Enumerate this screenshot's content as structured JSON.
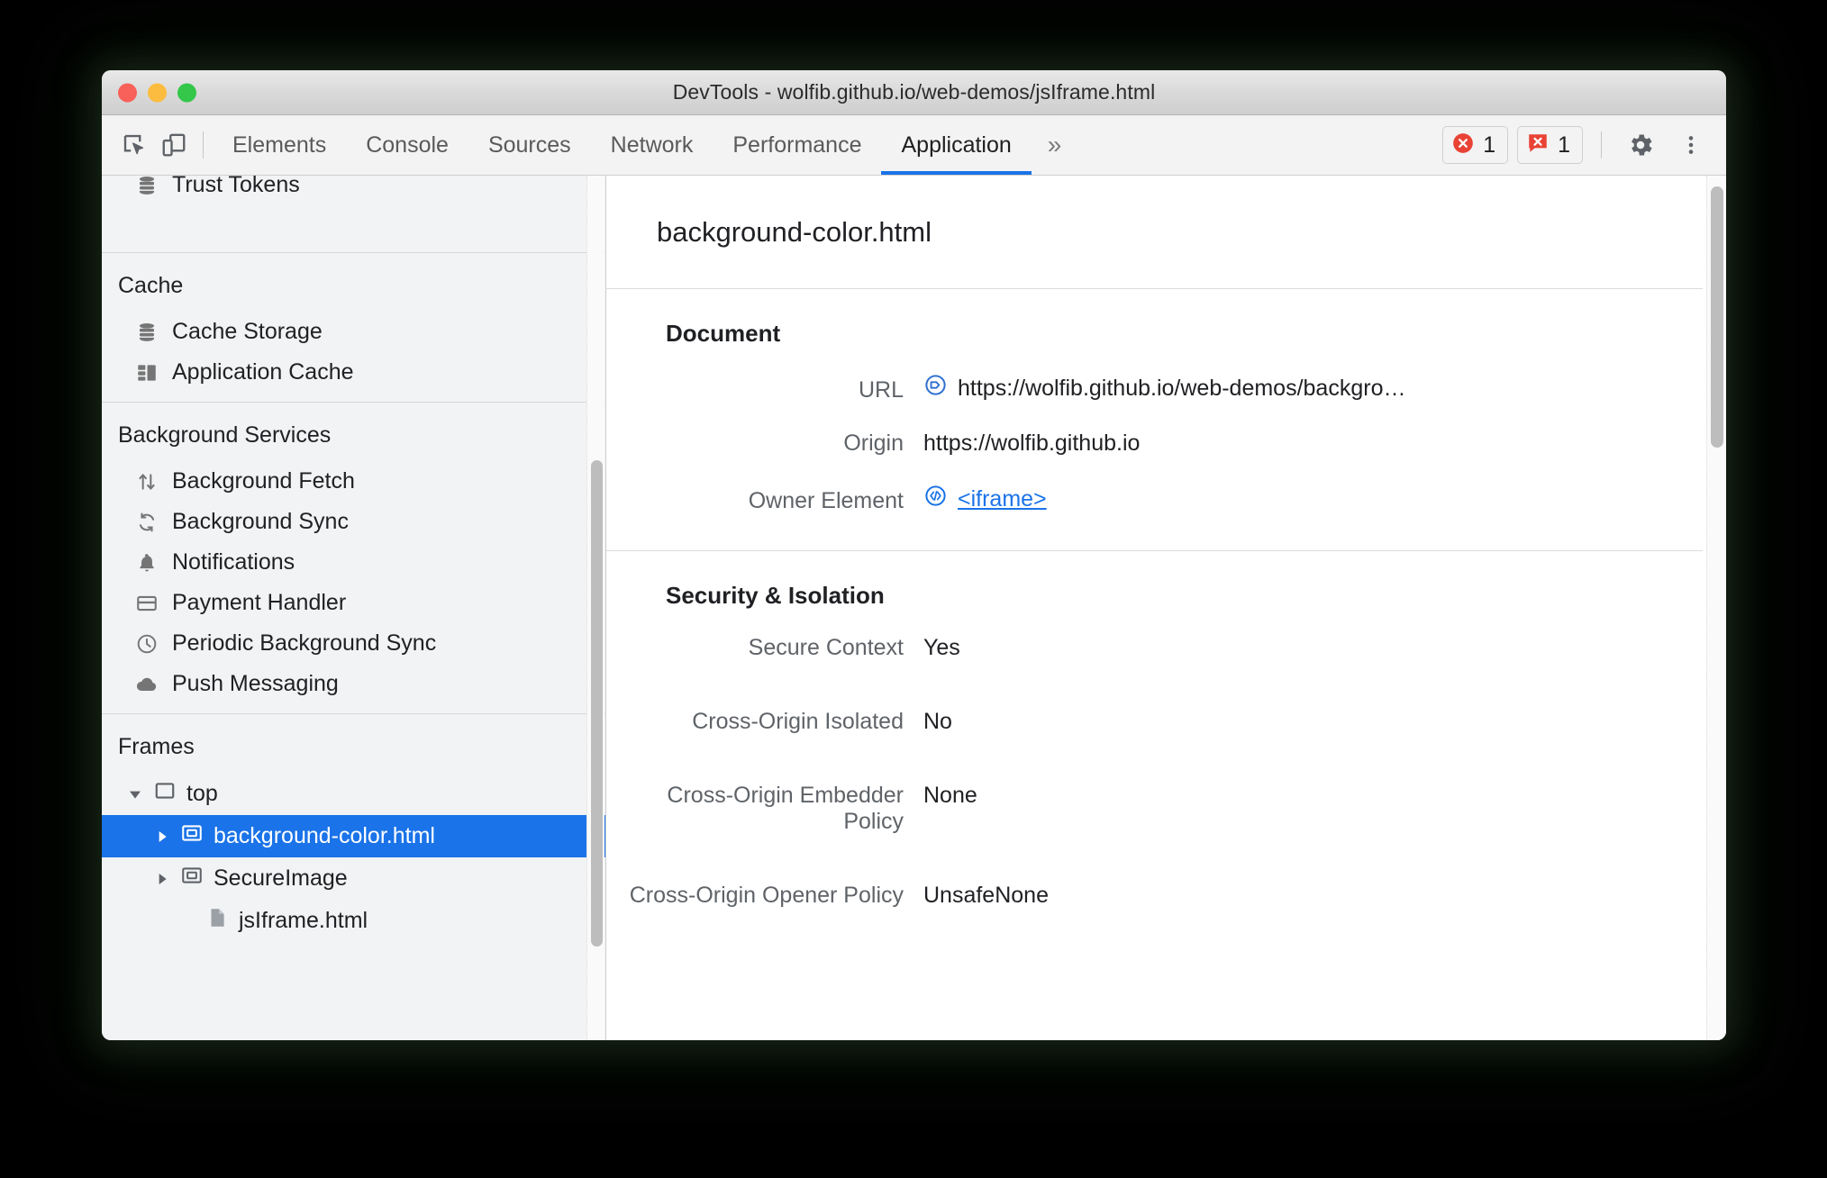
{
  "window": {
    "title": "DevTools - wolfib.github.io/web-demos/jsIframe.html",
    "traffic_lights": [
      "close-button",
      "minimize-button",
      "maximize-button"
    ]
  },
  "toolbar": {
    "inspect_icon": "inspect-element-icon",
    "device_icon": "device-toolbar-icon",
    "tabs": [
      {
        "label": "Elements",
        "active": false
      },
      {
        "label": "Console",
        "active": false
      },
      {
        "label": "Sources",
        "active": false
      },
      {
        "label": "Network",
        "active": false
      },
      {
        "label": "Performance",
        "active": false
      },
      {
        "label": "Application",
        "active": true
      }
    ],
    "more_tabs_label": "»",
    "badges": [
      {
        "icon": "error-circle-icon",
        "count": "1"
      },
      {
        "icon": "error-message-icon",
        "count": "1"
      }
    ],
    "settings_icon": "gear-icon",
    "menu_icon": "kebab-menu-icon",
    "accent_color": "#1a73e8",
    "error_color": "#e94335"
  },
  "sidebar": {
    "storage_partial": {
      "label": "Trust Tokens",
      "icon": "database-icon"
    },
    "sections": [
      {
        "title": "Cache",
        "items": [
          {
            "label": "Cache Storage",
            "icon": "database-icon"
          },
          {
            "label": "Application Cache",
            "icon": "grid-icon"
          }
        ]
      },
      {
        "title": "Background Services",
        "items": [
          {
            "label": "Background Fetch",
            "icon": "arrows-up-down-icon"
          },
          {
            "label": "Background Sync",
            "icon": "sync-icon"
          },
          {
            "label": "Notifications",
            "icon": "bell-icon"
          },
          {
            "label": "Payment Handler",
            "icon": "credit-card-icon"
          },
          {
            "label": "Periodic Background Sync",
            "icon": "clock-icon"
          },
          {
            "label": "Push Messaging",
            "icon": "cloud-icon"
          }
        ]
      }
    ],
    "frames": {
      "title": "Frames",
      "tree": [
        {
          "label": "top",
          "level": 1,
          "expanded": true,
          "icon": "frame-icon",
          "selected": false
        },
        {
          "label": "background-color.html",
          "level": 2,
          "expanded": false,
          "icon": "iframe-icon",
          "selected": true
        },
        {
          "label": "SecureImage",
          "level": 2,
          "expanded": false,
          "icon": "iframe-icon",
          "selected": false
        },
        {
          "label": "jsIframe.html",
          "level": 3,
          "expanded": null,
          "icon": "document-icon",
          "selected": false
        }
      ]
    },
    "selection_color": "#1a73e8"
  },
  "main": {
    "frame_title": "background-color.html",
    "sections": [
      {
        "heading": "Document",
        "rows": [
          {
            "key": "URL",
            "value": "https://wolfib.github.io/web-demos/backgro…",
            "icon": "url-tag-icon",
            "link": false
          },
          {
            "key": "Origin",
            "value": "https://wolfib.github.io",
            "icon": null,
            "link": false
          },
          {
            "key": "Owner Element",
            "value": "<iframe>",
            "icon": "code-brackets-icon",
            "link": true
          }
        ]
      },
      {
        "heading": "Security & Isolation",
        "rows": [
          {
            "key": "Secure Context",
            "value": "Yes",
            "icon": null,
            "link": false
          },
          {
            "key": "Cross-Origin Isolated",
            "value": "No",
            "icon": null,
            "link": false
          },
          {
            "key": "Cross-Origin Embedder Policy",
            "value": "None",
            "icon": null,
            "link": false
          },
          {
            "key": "Cross-Origin Opener Policy",
            "value": "UnsafeNone",
            "icon": null,
            "link": false
          }
        ]
      }
    ]
  }
}
